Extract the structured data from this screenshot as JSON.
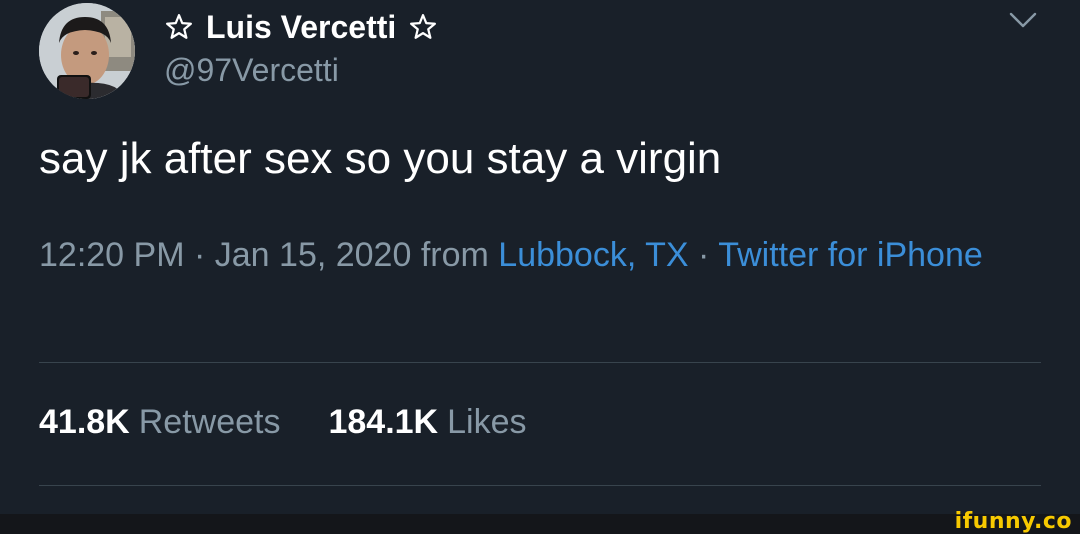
{
  "author": {
    "display_name": "Luis Vercetti",
    "name_decoration_icon": "outline-star-icon",
    "handle": "@97Vercetti"
  },
  "menu": {
    "icon": "chevron-down-icon"
  },
  "tweet": {
    "text": "say jk after sex so you stay a virgin",
    "time": "12:20 PM",
    "separator": "·",
    "date": "Jan 15, 2020",
    "from_word": "from",
    "location": "Lubbock, TX",
    "source": "Twitter for iPhone"
  },
  "stats": {
    "retweets_count": "41.8K",
    "retweets_label": "Retweets",
    "likes_count": "184.1K",
    "likes_label": "Likes"
  },
  "watermark": "ifunny.co",
  "colors": {
    "background": "#192029",
    "primary_text": "#ffffff",
    "secondary_text": "#8899a6",
    "link": "#3b8ed8",
    "divider": "#38444d",
    "watermark": "#f7c900"
  }
}
